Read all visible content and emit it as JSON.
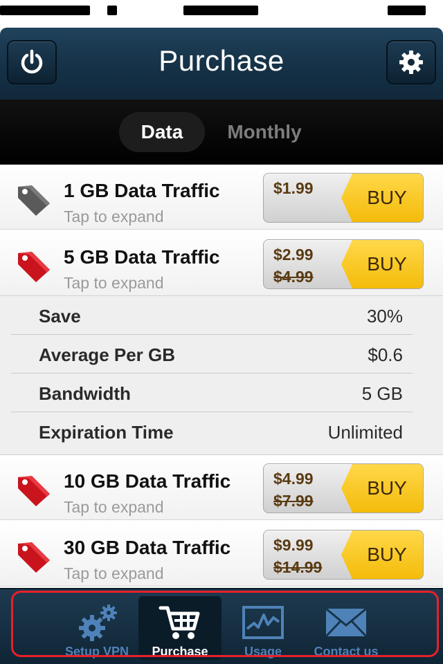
{
  "navbar": {
    "title": "Purchase"
  },
  "segments": {
    "active": "Data",
    "inactive": "Monthly"
  },
  "products": [
    {
      "title": "1 GB Data Traffic",
      "subtitle": "Tap to expand",
      "price": "$1.99",
      "old_price": "",
      "buy": "BUY",
      "tag_color": "#555555"
    },
    {
      "title": "5 GB Data Traffic",
      "subtitle": "Tap to expand",
      "price": "$2.99",
      "old_price": "$4.99",
      "buy": "BUY",
      "tag_color": "#d4202a"
    },
    {
      "title": "10 GB Data Traffic",
      "subtitle": "Tap to expand",
      "price": "$4.99",
      "old_price": "$7.99",
      "buy": "BUY",
      "tag_color": "#d4202a"
    },
    {
      "title": "30 GB Data Traffic",
      "subtitle": "Tap to expand",
      "price": "$9.99",
      "old_price": "$14.99",
      "buy": "BUY",
      "tag_color": "#d4202a"
    }
  ],
  "details": [
    {
      "label": "Save",
      "value": "30%"
    },
    {
      "label": "Average Per GB",
      "value": "$0.6"
    },
    {
      "label": "Bandwidth",
      "value": "5 GB"
    },
    {
      "label": "Expiration Time",
      "value": "Unlimited"
    }
  ],
  "tabs": [
    {
      "label": "Setup VPN",
      "icon": "gears-icon"
    },
    {
      "label": "Purchase",
      "icon": "cart-icon",
      "active": true
    },
    {
      "label": "Usage",
      "icon": "chart-icon"
    },
    {
      "label": "Contact us",
      "icon": "envelope-icon"
    }
  ],
  "colors": {
    "accent_buy": "#f7c515",
    "price_text": "#5a3a12",
    "highlight_frame": "#e8202a"
  }
}
